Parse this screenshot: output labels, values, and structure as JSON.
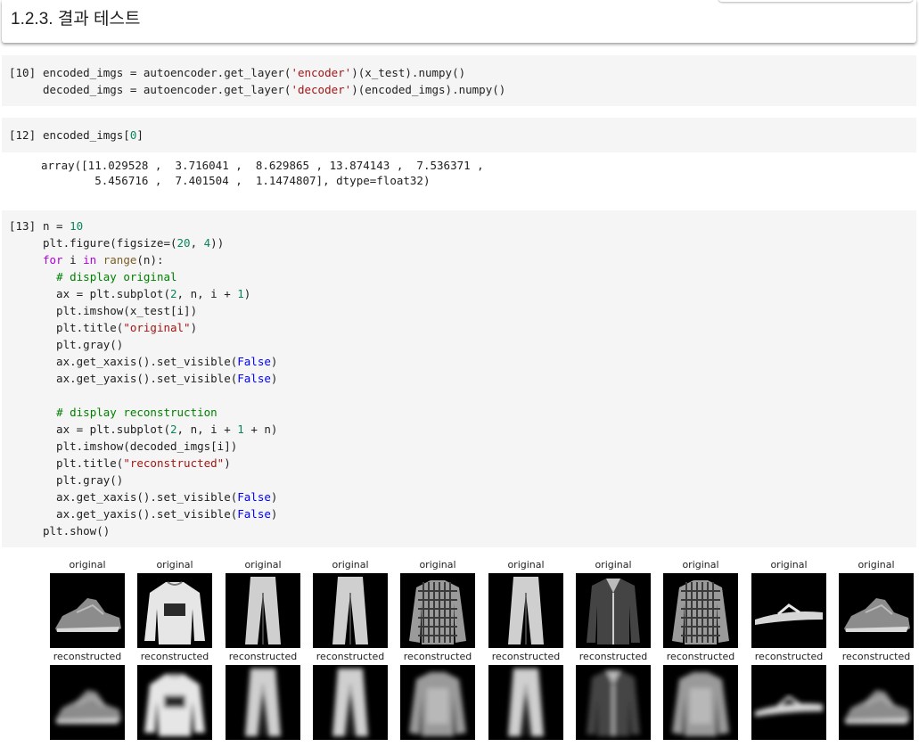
{
  "header": {
    "title": "1.2.3. 결과 테스트"
  },
  "cells": [
    {
      "prompt": "[10]",
      "lines": [
        [
          [
            "t",
            "encoded_imgs = autoencoder.get_layer("
          ],
          [
            "s",
            "'encoder'"
          ],
          [
            "t",
            ")(x_test).numpy()"
          ]
        ],
        [
          [
            "t",
            "decoded_imgs = autoencoder.get_layer("
          ],
          [
            "s",
            "'decoder'"
          ],
          [
            "t",
            ")(encoded_imgs).numpy()"
          ]
        ]
      ]
    },
    {
      "prompt": "[12]",
      "lines": [
        [
          [
            "t",
            "encoded_imgs["
          ],
          [
            "n",
            "0"
          ],
          [
            "t",
            "]"
          ]
        ]
      ],
      "output": "array([11.029528 ,  3.716041 ,  8.629865 , 13.874143 ,  7.536371 ,\n        5.456716 ,  7.401504 ,  1.1474807], dtype=float32)"
    },
    {
      "prompt": "[13]",
      "lines": [
        [
          [
            "t",
            "n = "
          ],
          [
            "n",
            "10"
          ]
        ],
        [
          [
            "t",
            "plt.figure(figsize=("
          ],
          [
            "n",
            "20"
          ],
          [
            "t",
            ", "
          ],
          [
            "n",
            "4"
          ],
          [
            "t",
            "))"
          ]
        ],
        [
          [
            "k",
            "for"
          ],
          [
            "t",
            " i "
          ],
          [
            "k",
            "in"
          ],
          [
            "t",
            " "
          ],
          [
            "b",
            "range"
          ],
          [
            "t",
            "(n):"
          ]
        ],
        [
          [
            "t",
            "  "
          ],
          [
            "c",
            "# display original"
          ]
        ],
        [
          [
            "t",
            "  ax = plt.subplot("
          ],
          [
            "n",
            "2"
          ],
          [
            "t",
            ", n, i + "
          ],
          [
            "n",
            "1"
          ],
          [
            "t",
            ")"
          ]
        ],
        [
          [
            "t",
            "  plt.imshow(x_test[i])"
          ]
        ],
        [
          [
            "t",
            "  plt.title("
          ],
          [
            "s",
            "\"original\""
          ],
          [
            "t",
            ")"
          ]
        ],
        [
          [
            "t",
            "  plt.gray()"
          ]
        ],
        [
          [
            "t",
            "  ax.get_xaxis().set_visible("
          ],
          [
            "x",
            "False"
          ],
          [
            "t",
            ")"
          ]
        ],
        [
          [
            "t",
            "  ax.get_yaxis().set_visible("
          ],
          [
            "x",
            "False"
          ],
          [
            "t",
            ")"
          ]
        ],
        [
          [
            "t",
            ""
          ]
        ],
        [
          [
            "t",
            "  "
          ],
          [
            "c",
            "# display reconstruction"
          ]
        ],
        [
          [
            "t",
            "  ax = plt.subplot("
          ],
          [
            "n",
            "2"
          ],
          [
            "t",
            ", n, i + "
          ],
          [
            "n",
            "1"
          ],
          [
            "t",
            " + n)"
          ]
        ],
        [
          [
            "t",
            "  plt.imshow(decoded_imgs[i])"
          ]
        ],
        [
          [
            "t",
            "  plt.title("
          ],
          [
            "s",
            "\"reconstructed\""
          ],
          [
            "t",
            ")"
          ]
        ],
        [
          [
            "t",
            "  plt.gray()"
          ]
        ],
        [
          [
            "t",
            "  ax.get_xaxis().set_visible("
          ],
          [
            "x",
            "False"
          ],
          [
            "t",
            ")"
          ]
        ],
        [
          [
            "t",
            "  ax.get_yaxis().set_visible("
          ],
          [
            "x",
            "False"
          ],
          [
            "t",
            ")"
          ]
        ],
        [
          [
            "t",
            "plt.show()"
          ]
        ]
      ]
    }
  ],
  "figure": {
    "original_title": "original",
    "reconstructed_title": "reconstructed",
    "items": [
      "sneaker",
      "pullover",
      "trouser",
      "trouser",
      "shirt",
      "trouser",
      "coat",
      "shirt",
      "sandal",
      "sneaker"
    ]
  },
  "colors": {
    "cell_bg": "#f5f5f5",
    "string": "#a31515",
    "number": "#098658",
    "keyword": "#af00db",
    "builtin": "#795e26",
    "constant": "#0000ff",
    "comment": "#008000"
  }
}
